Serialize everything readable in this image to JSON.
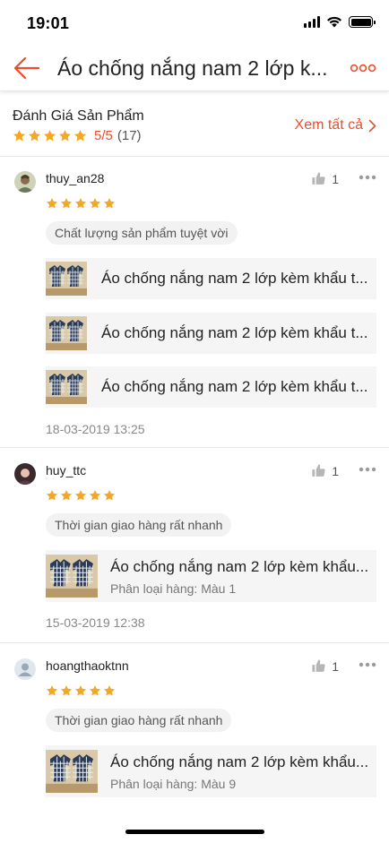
{
  "status_bar": {
    "time": "19:01"
  },
  "nav": {
    "title": "Áo chống nắng nam 2 lớp k..."
  },
  "summary": {
    "title": "Đánh Giá Sản Phẩm",
    "score": "5/5",
    "count": "(17)",
    "rating": 5,
    "see_all": "Xem tất cả"
  },
  "colors": {
    "accent": "#ee4d2d",
    "star": "#f6a623"
  },
  "reviews": [
    {
      "username": "thuy_an28",
      "likes": "1",
      "rating": 5,
      "tag": "Chất lượng sản phẩm tuyệt vời",
      "products": [
        {
          "name": "Áo chống nắng nam 2 lớp kèm khẩu t..."
        },
        {
          "name": "Áo chống nắng nam 2 lớp kèm khẩu t..."
        },
        {
          "name": "Áo chống nắng nam 2 lớp kèm khẩu t..."
        }
      ],
      "date": "18-03-2019 13:25"
    },
    {
      "username": "huy_ttc",
      "likes": "1",
      "rating": 5,
      "tag": "Thời gian giao hàng rất nhanh",
      "product": {
        "name": "Áo chống nắng nam 2 lớp kèm khẩu...",
        "variant": "Phân loại hàng: Màu 1"
      },
      "date": "15-03-2019 12:38"
    },
    {
      "username": "hoangthaoktnn",
      "likes": "1",
      "rating": 5,
      "tag": "Thời gian giao hàng rất nhanh",
      "product": {
        "name": "Áo chống nắng nam 2 lớp kèm khẩu...",
        "variant": "Phân loại hàng: Màu 9"
      }
    }
  ]
}
